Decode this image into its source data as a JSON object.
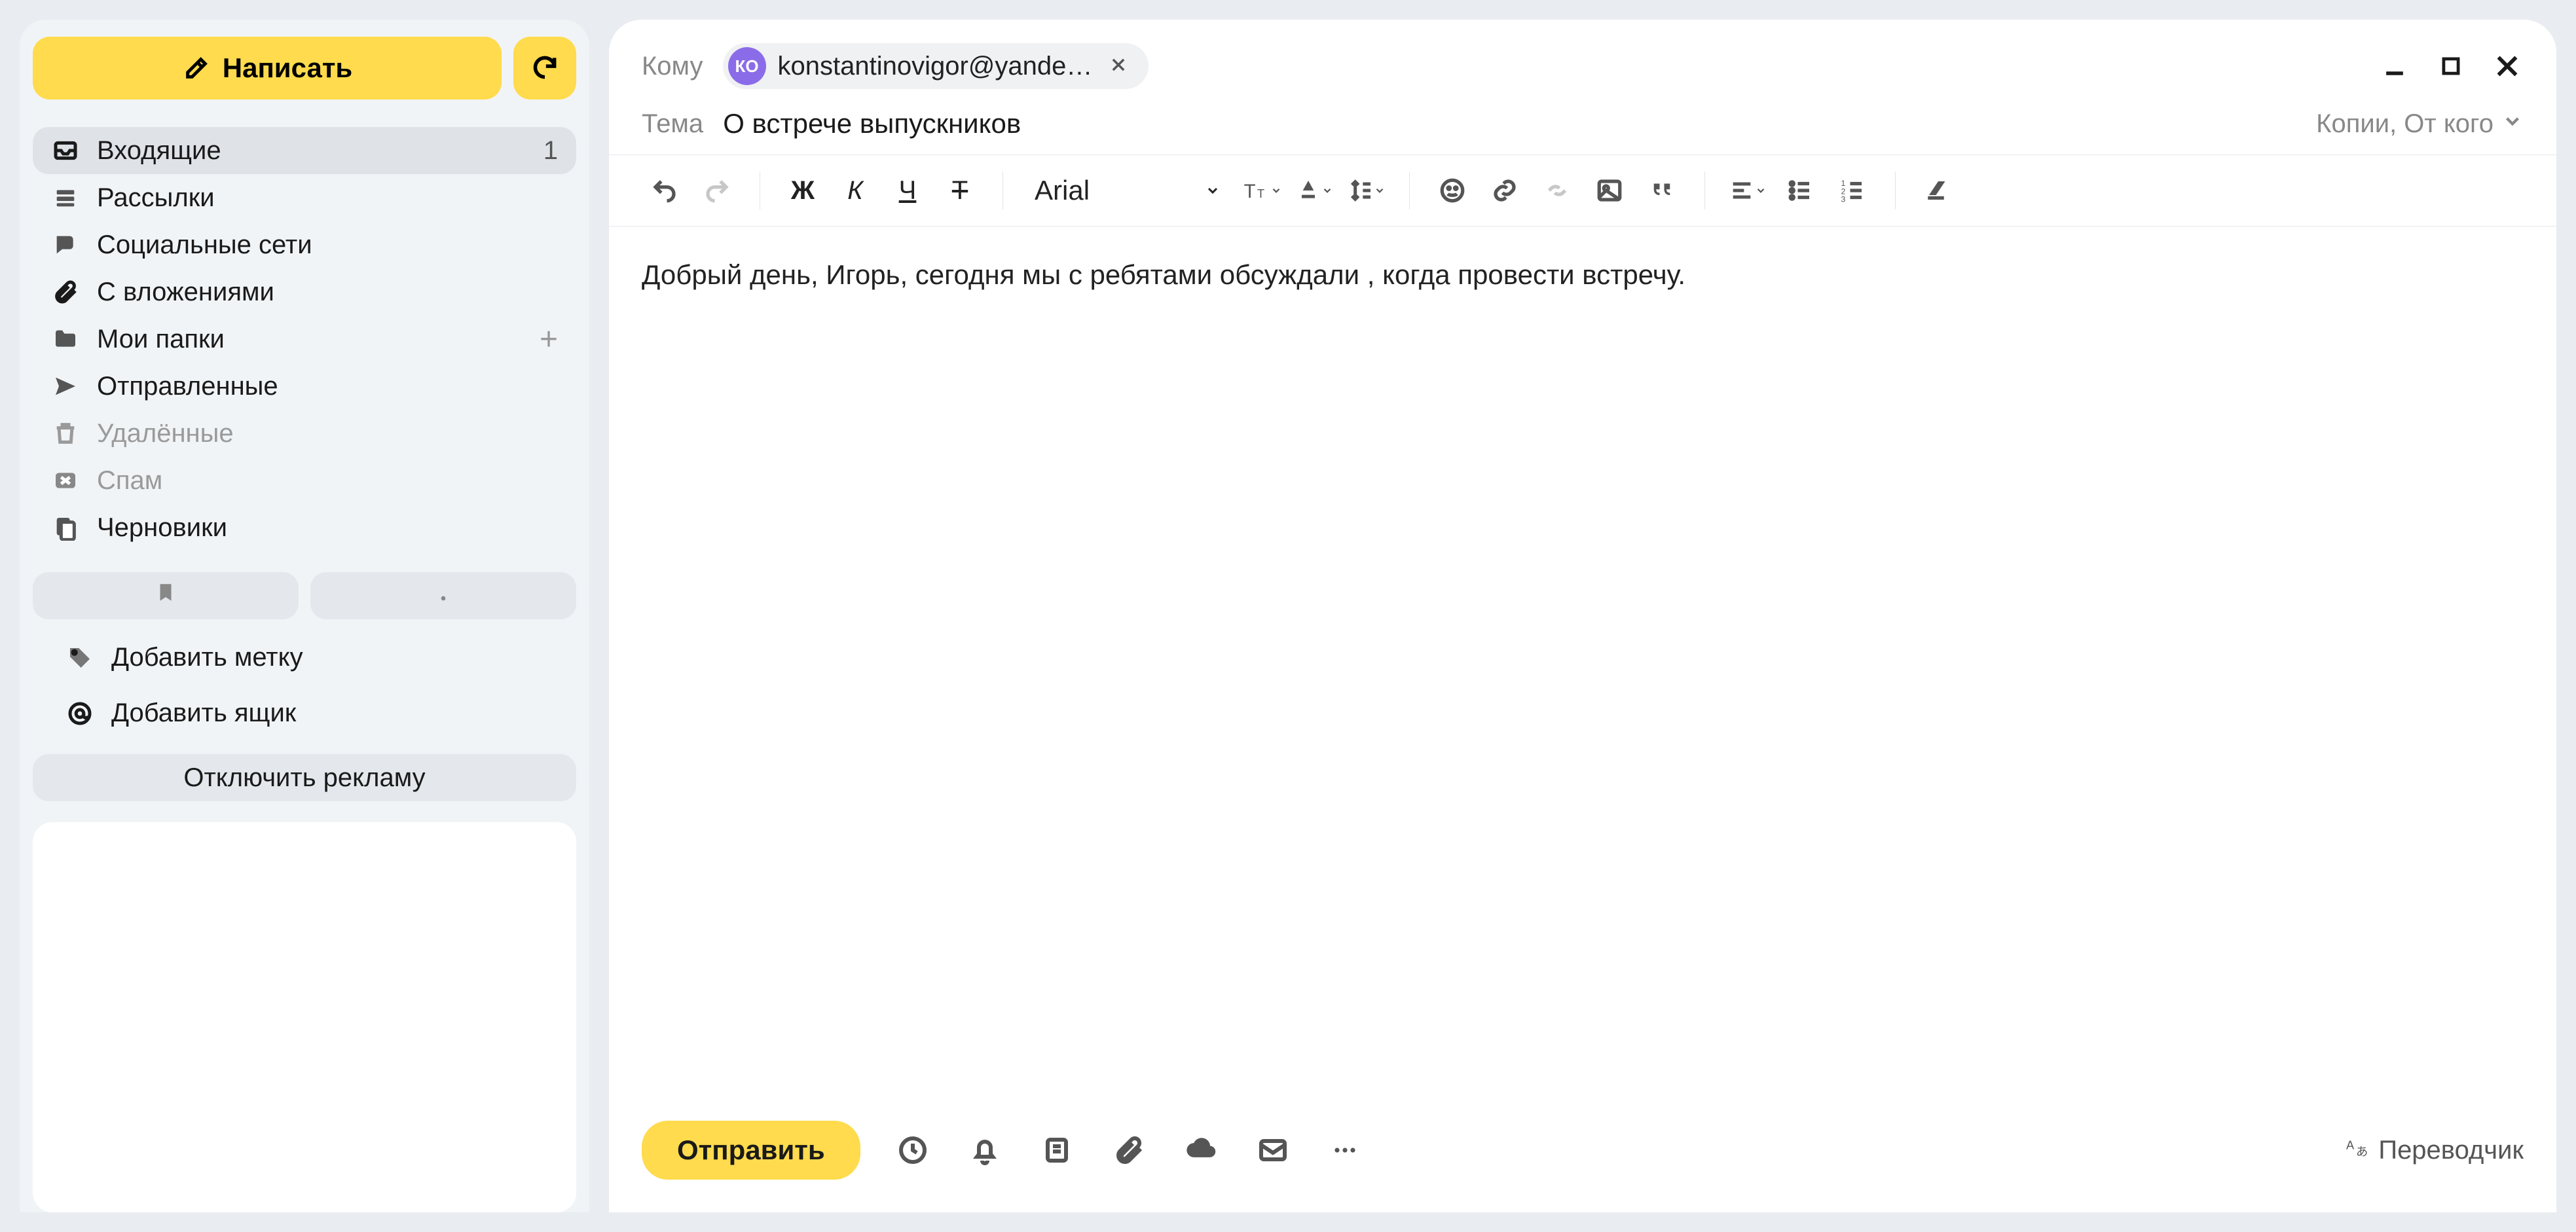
{
  "sidebar": {
    "compose_label": "Написать",
    "folders": [
      {
        "id": "inbox",
        "label": "Входящие",
        "count": "1",
        "active": true,
        "muted": false,
        "icon": "inbox"
      },
      {
        "id": "newsletters",
        "label": "Рассылки",
        "count": "",
        "active": false,
        "muted": false,
        "icon": "stack"
      },
      {
        "id": "social",
        "label": "Социальные сети",
        "count": "",
        "active": false,
        "muted": false,
        "icon": "chat"
      },
      {
        "id": "attachments",
        "label": "С вложениями",
        "count": "",
        "active": false,
        "muted": false,
        "icon": "paperclip"
      },
      {
        "id": "myfolders",
        "label": "Мои папки",
        "count": "",
        "active": false,
        "muted": false,
        "icon": "folder",
        "addable": true
      },
      {
        "id": "sent",
        "label": "Отправленные",
        "count": "",
        "active": false,
        "muted": false,
        "icon": "send"
      },
      {
        "id": "trash",
        "label": "Удалённые",
        "count": "",
        "active": false,
        "muted": true,
        "icon": "trash"
      },
      {
        "id": "spam",
        "label": "Спам",
        "count": "",
        "active": false,
        "muted": true,
        "icon": "spam"
      },
      {
        "id": "drafts",
        "label": "Черновики",
        "count": "",
        "active": false,
        "muted": false,
        "icon": "draft"
      }
    ],
    "add_label": "Добавить метку",
    "add_mailbox": "Добавить ящик",
    "ad_off": "Отключить рекламу"
  },
  "compose": {
    "to_label": "Кому",
    "chip": {
      "initials": "КО",
      "email": "konstantinovigor@yande…"
    },
    "subject_label": "Тема",
    "subject_value": "О встрече выпускников",
    "copies_label": "Копии, От кого",
    "font_name": "Arial",
    "format_buttons": {
      "bold": "Ж",
      "italic": "К",
      "underline": "Ч",
      "strike": "Т"
    },
    "body": "Добрый день, Игорь, сегодня мы с ребятами обсуждали , когда провести встречу.",
    "send_label": "Отправить",
    "translator_label": "Переводчик"
  }
}
